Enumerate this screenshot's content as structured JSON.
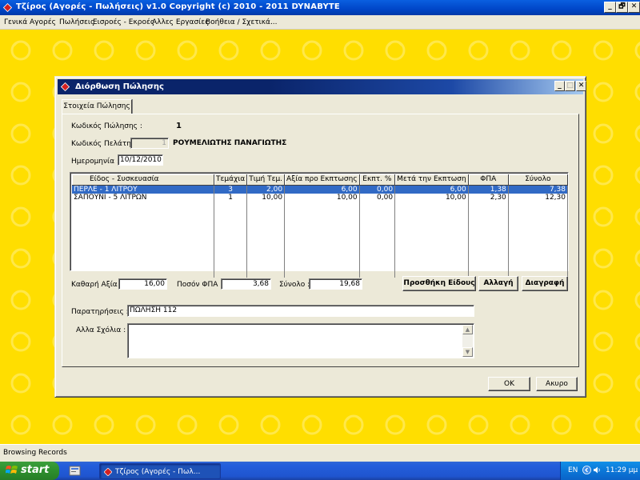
{
  "app": {
    "title": "Τζίρος (Αγορές - Πωλήσεις)  v1.0    Copyright (c) 2010 - 2011  DYNABYTE",
    "minimize": "_",
    "restore": "🗗",
    "close": "✕"
  },
  "menu": [
    "Γενικά",
    "Αγορές",
    "Πωλήσεις",
    "Εισροές - Εκροές",
    "Αλλες Εργασίες",
    "Βοήθεια / Σχετικά..."
  ],
  "dialog": {
    "title": "Διόρθωση Πώλησης",
    "tab": "Στοιχεία Πώλησης",
    "sale_code_label": "Κωδικός Πώλησης :",
    "sale_code_value": "1",
    "customer_code_label": "Κωδικός Πελάτη :",
    "customer_code_value": "1",
    "customer_name": "ΡΟΥΜΕΛΙΩΤΗΣ ΠΑΝΑΓΙΩΤΗΣ",
    "date_label": "Ημερομηνία :",
    "date_value": "10/12/2010",
    "grid": {
      "columns": [
        "Είδος - Συσκευασία",
        "Τεμάχια",
        "Τιμή Τεμ.",
        "Αξία προ Εκπτωσης",
        "Εκπτ. %",
        "Μετά την Εκπτωση",
        "ΦΠΑ",
        "Σύνολο"
      ],
      "rows": [
        [
          "ΠΕΡΛΕ - 1 ΛΙΤΡΟΥ",
          "3",
          "2,00",
          "6,00",
          "0,00",
          "6,00",
          "1,38",
          "7,38"
        ],
        [
          "ΣΑΠΟΥΝΙ - 5 ΛΙΤΡΩΝ",
          "1",
          "10,00",
          "10,00",
          "0,00",
          "10,00",
          "2,30",
          "12,30"
        ]
      ]
    },
    "net_label": "Καθαρή Αξία :",
    "net_value": "16,00",
    "vat_label": "Ποσόν ΦΠΑ :",
    "vat_value": "3,68",
    "total_label": "Σύνολο :",
    "total_value": "19,68",
    "add_item_button": "Προσθήκη Είδους",
    "change_button": "Αλλαγή",
    "delete_button": "Διαγραφή",
    "remarks_label": "Παρατηρήσεις :",
    "remarks_value": "ΠΩΛΗΣΗ 112",
    "other_comments_label": "Αλλα Σχόλια :",
    "other_comments_value": "",
    "ok_button": "OK",
    "cancel_button": "Ακυρο"
  },
  "status": {
    "text": "Browsing Records"
  },
  "taskbar": {
    "start": "start",
    "task": "Τζίρος (Αγορές - Πωλ...",
    "lang": "EN",
    "clock": "11:29 μμ"
  }
}
